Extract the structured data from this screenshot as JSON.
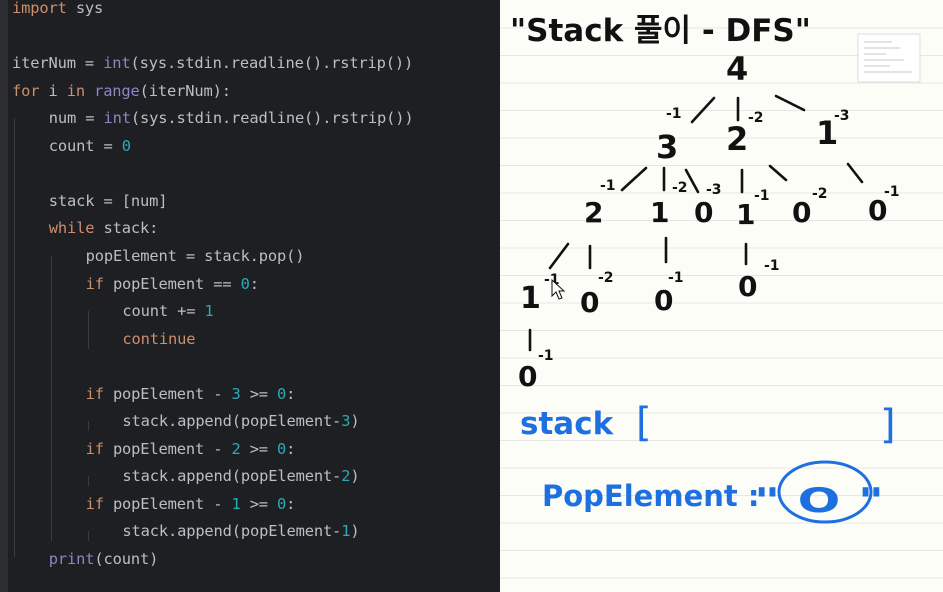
{
  "code": [
    {
      "indent": 0,
      "tokens": [
        {
          "t": "import",
          "c": "kw"
        },
        {
          "t": " sys",
          "c": "id"
        }
      ]
    },
    {
      "indent": 0,
      "tokens": []
    },
    {
      "indent": 0,
      "tokens": [
        {
          "t": "iterNum = ",
          "c": "id"
        },
        {
          "t": "int",
          "c": "bi"
        },
        {
          "t": "(sys.stdin.readline().rstrip())",
          "c": "id"
        }
      ]
    },
    {
      "indent": 0,
      "tokens": [
        {
          "t": "for",
          "c": "kw"
        },
        {
          "t": " i ",
          "c": "id"
        },
        {
          "t": "in",
          "c": "kw"
        },
        {
          "t": " ",
          "c": "id"
        },
        {
          "t": "range",
          "c": "bi"
        },
        {
          "t": "(iterNum):",
          "c": "id"
        }
      ]
    },
    {
      "indent": 1,
      "tokens": [
        {
          "t": "num = ",
          "c": "id"
        },
        {
          "t": "int",
          "c": "bi"
        },
        {
          "t": "(sys.stdin.readline().rstrip())",
          "c": "id"
        }
      ]
    },
    {
      "indent": 1,
      "tokens": [
        {
          "t": "count = ",
          "c": "id"
        },
        {
          "t": "0",
          "c": "num"
        }
      ]
    },
    {
      "indent": 0,
      "tokens": []
    },
    {
      "indent": 1,
      "tokens": [
        {
          "t": "stack = [num]",
          "c": "id"
        }
      ]
    },
    {
      "indent": 1,
      "tokens": [
        {
          "t": "while",
          "c": "kw"
        },
        {
          "t": " stack:",
          "c": "id"
        }
      ]
    },
    {
      "indent": 2,
      "tokens": [
        {
          "t": "popElement = stack.pop()",
          "c": "id"
        }
      ]
    },
    {
      "indent": 2,
      "tokens": [
        {
          "t": "if",
          "c": "kw"
        },
        {
          "t": " popElement == ",
          "c": "id"
        },
        {
          "t": "0",
          "c": "num"
        },
        {
          "t": ":",
          "c": "id"
        }
      ]
    },
    {
      "indent": 3,
      "tokens": [
        {
          "t": "count += ",
          "c": "id"
        },
        {
          "t": "1",
          "c": "num"
        }
      ]
    },
    {
      "indent": 3,
      "tokens": [
        {
          "t": "continue",
          "c": "kw"
        }
      ]
    },
    {
      "indent": 0,
      "tokens": []
    },
    {
      "indent": 2,
      "tokens": [
        {
          "t": "if",
          "c": "kw"
        },
        {
          "t": " popElement - ",
          "c": "id"
        },
        {
          "t": "3",
          "c": "num"
        },
        {
          "t": " >= ",
          "c": "id"
        },
        {
          "t": "0",
          "c": "num"
        },
        {
          "t": ":",
          "c": "id"
        }
      ]
    },
    {
      "indent": 3,
      "tokens": [
        {
          "t": "stack.append(popElement-",
          "c": "id"
        },
        {
          "t": "3",
          "c": "num"
        },
        {
          "t": ")",
          "c": "id"
        }
      ]
    },
    {
      "indent": 2,
      "tokens": [
        {
          "t": "if",
          "c": "kw"
        },
        {
          "t": " popElement - ",
          "c": "id"
        },
        {
          "t": "2",
          "c": "num"
        },
        {
          "t": " >= ",
          "c": "id"
        },
        {
          "t": "0",
          "c": "num"
        },
        {
          "t": ":",
          "c": "id"
        }
      ]
    },
    {
      "indent": 3,
      "tokens": [
        {
          "t": "stack.append(popElement-",
          "c": "id"
        },
        {
          "t": "2",
          "c": "num"
        },
        {
          "t": ")",
          "c": "id"
        }
      ]
    },
    {
      "indent": 2,
      "tokens": [
        {
          "t": "if",
          "c": "kw"
        },
        {
          "t": " popElement - ",
          "c": "id"
        },
        {
          "t": "1",
          "c": "num"
        },
        {
          "t": " >= ",
          "c": "id"
        },
        {
          "t": "0",
          "c": "num"
        },
        {
          "t": ":",
          "c": "id"
        }
      ]
    },
    {
      "indent": 3,
      "tokens": [
        {
          "t": "stack.append(popElement-",
          "c": "id"
        },
        {
          "t": "1",
          "c": "num"
        },
        {
          "t": ")",
          "c": "id"
        }
      ]
    },
    {
      "indent": 1,
      "tokens": [
        {
          "t": "print",
          "c": "bi"
        },
        {
          "t": "(count)",
          "c": "id"
        }
      ]
    }
  ],
  "notes": {
    "title": "\"Stack 풀이 - DFS\"",
    "tree": {
      "root": "4",
      "level1": [
        "3",
        "2",
        "1"
      ],
      "level2": [
        "2",
        "1",
        "0",
        "1",
        "0",
        "0"
      ],
      "level3": [
        "1",
        "0",
        "0",
        "0"
      ],
      "level4": [
        "0"
      ],
      "edge_labels": [
        "-1",
        "-2",
        "-3",
        "-1",
        "-2",
        "-3",
        "-1",
        "-2",
        "-1",
        "-1",
        "-2",
        "-1",
        "-1",
        "-1"
      ]
    },
    "stack_label": "stack",
    "stack_open": "[",
    "stack_close": "]",
    "pop_label": "PopElement :",
    "pop_value": "\" O \""
  },
  "colors": {
    "keyword": "#cf8e6d",
    "builtin": "#8888c6",
    "number": "#2aacb8",
    "text": "#bcbec4",
    "ink": "#111111",
    "blue_ink": "#1e6fe0",
    "paper": "#fdfdf8"
  }
}
